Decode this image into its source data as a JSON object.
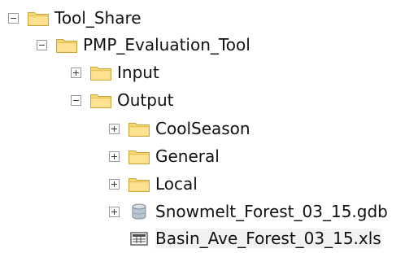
{
  "tree": {
    "items": [
      {
        "label": "Tool_Share",
        "expander": "minus",
        "icon": "folder-icon"
      },
      {
        "label": "PMP_Evaluation_Tool",
        "expander": "minus",
        "icon": "folder-icon"
      },
      {
        "label": "Input",
        "expander": "plus",
        "icon": "folder-icon"
      },
      {
        "label": "Output",
        "expander": "minus",
        "icon": "folder-icon"
      },
      {
        "label": "CoolSeason",
        "expander": "plus",
        "icon": "folder-icon"
      },
      {
        "label": "General",
        "expander": "plus",
        "icon": "folder-icon"
      },
      {
        "label": "Local",
        "expander": "plus",
        "icon": "folder-icon"
      },
      {
        "label": "Snowmelt_Forest_03_15.gdb",
        "expander": "plus",
        "icon": "geodatabase-icon"
      },
      {
        "label": "Basin_Ave_Forest_03_15.xls",
        "expander": "none",
        "icon": "table-icon"
      }
    ]
  },
  "colors": {
    "folder_fill": "#f5d776",
    "folder_outline": "#c8a53a",
    "geodatabase_fill": "#b7c3cf",
    "table_outline": "#4a4a4a"
  }
}
